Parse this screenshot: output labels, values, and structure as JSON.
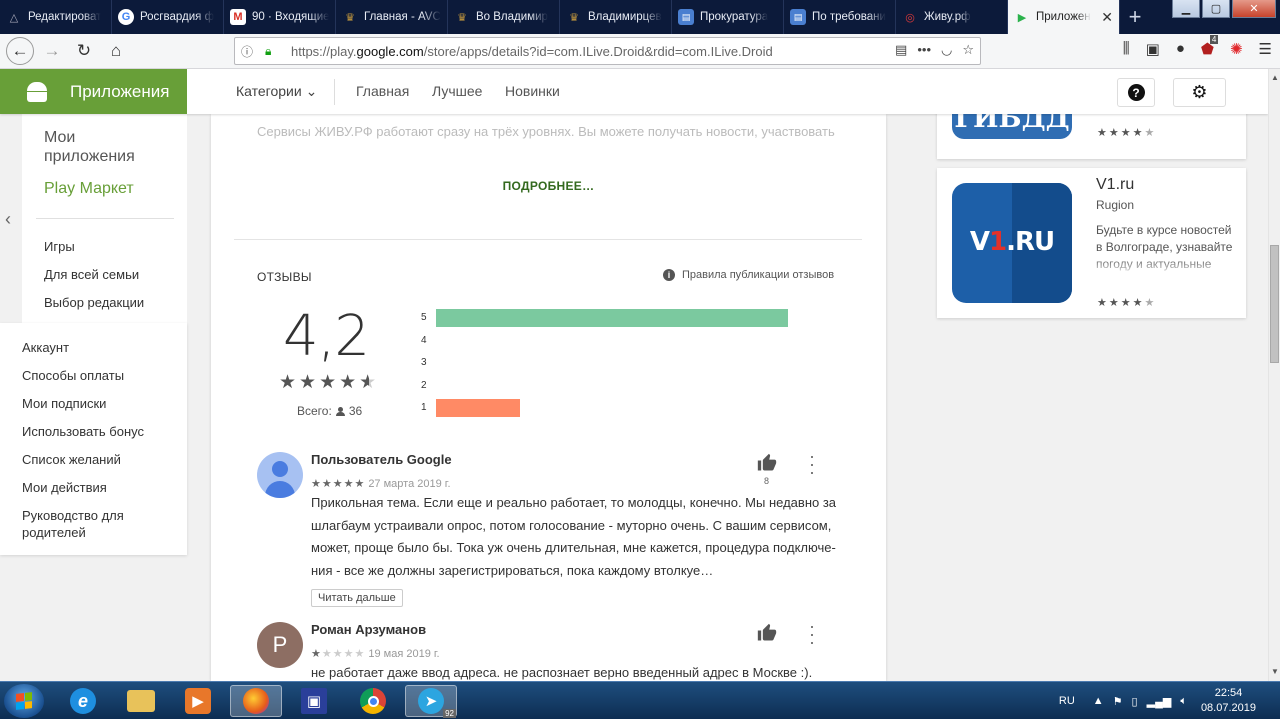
{
  "browser": {
    "tabs": [
      {
        "label": "Редактироват",
        "icon": "triangle-icon",
        "color": "#8a8f98"
      },
      {
        "label": "Росгвардия ф",
        "icon": "google-g-icon",
        "color": "#ffffff"
      },
      {
        "label": "90 · Входящие",
        "icon": "gmail-icon",
        "color": "#d93025"
      },
      {
        "label": "Главная - AVC",
        "icon": "emblem-icon",
        "color": "#b58a3a"
      },
      {
        "label": "Во Владимир",
        "icon": "emblem-icon",
        "color": "#b58a3a"
      },
      {
        "label": "Владимирцев",
        "icon": "emblem-icon",
        "color": "#b58a3a"
      },
      {
        "label": "Прокуратура",
        "icon": "doc-icon",
        "color": "#4a7fd0"
      },
      {
        "label": "По требовани",
        "icon": "doc-icon",
        "color": "#4a7fd0"
      },
      {
        "label": "Живу.рф",
        "icon": "zhivu-icon",
        "color": "#d92b2b"
      },
      {
        "label": "Приложен",
        "icon": "play-icon",
        "color": "#2bb24c"
      }
    ],
    "url_prefix": "https://play.",
    "url_domain": "google.com",
    "url_path": "/store/apps/details?id=com.ILive.Droid&rdid=com.ILive.Droid",
    "ublock_count": "4"
  },
  "store": {
    "brand": "Приложения",
    "nav": {
      "categories": "Категории",
      "home": "Главная",
      "top": "Лучшее",
      "new": "Новинки"
    },
    "sidebar": {
      "my_apps": "Мои приложения",
      "play_market": "Play Маркет",
      "items": [
        "Игры",
        "Для всей семьи",
        "Выбор редакции"
      ]
    },
    "account_menu": [
      "Аккаунт",
      "Способы оплаты",
      "Мои подписки",
      "Использовать бонус",
      "Список желаний",
      "Мои действия",
      "Руководство для родителей"
    ]
  },
  "app": {
    "description": "Сервисы ЖИВУ.РФ работают сразу на трёх уровнях. Вы можете получать новости, участвовать",
    "more_label": "ПОДРОБНЕЕ…",
    "reviews_title": "ОТЗЫВЫ",
    "policy_label": "Правила публикации отзывов",
    "rating": "4,2",
    "total_label": "Всего:",
    "total_count": "36",
    "histogram": [
      {
        "stars": "5",
        "fraction": 1.0,
        "color": "#7bc99f"
      },
      {
        "stars": "4",
        "fraction": 0,
        "color": "#7bc99f"
      },
      {
        "stars": "3",
        "fraction": 0,
        "color": "#7bc99f"
      },
      {
        "stars": "2",
        "fraction": 0,
        "color": "#ff8a65"
      },
      {
        "stars": "1",
        "fraction": 0.24,
        "color": "#ff8a65"
      }
    ],
    "reviews": [
      {
        "author": "Пользователь Google",
        "stars": 5,
        "date": "27 марта 2019 г.",
        "text": "Прикольная тема. Если еще и реально работает, то молодцы, конечно. Мы недавно за шлагбаум устраивали опрос, потом голосование - муторно очень. С вашим сервисом, может, проще было бы. Тока уж очень длительная, мне кажется, процедура подключе-ния - все же должны зарегистрироваться, пока каждому втолкуе…",
        "likes": "8",
        "read_more": "Читать дальше"
      },
      {
        "author": "Роман Арзуманов",
        "avatar_letter": "P",
        "stars": 1,
        "date": "19 мая 2019 г.",
        "text": "не работает даже ввод адреса. не распознает верно введенный адрес в Москве :)."
      }
    ]
  },
  "similar": [
    {
      "icon_text": "ГИБДД",
      "rating_stars": "4.5"
    },
    {
      "title": "V1.ru",
      "developer": "Rugion",
      "description": "Будьте в курсе новостей в Волгограде, узнавайте погоду и актуальные",
      "icon_text_a": "V",
      "icon_text_b": "1",
      "icon_text_c": ".RU",
      "rating_stars": "4.5"
    }
  ],
  "taskbar": {
    "lang": "RU",
    "time": "22:54",
    "date": "08.07.2019",
    "telegram_badge": "92"
  }
}
